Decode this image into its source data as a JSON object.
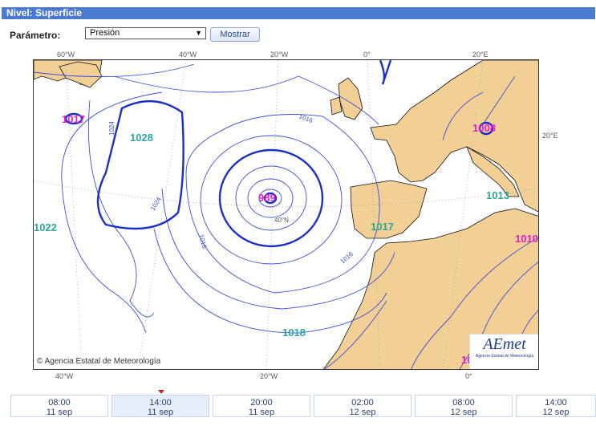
{
  "header": {
    "title": "Nivel: Superficie"
  },
  "form": {
    "param_label": "Parámetro:",
    "selected": "Presión",
    "button": "Mostrar"
  },
  "map": {
    "lon_top": [
      "60°W",
      "40°W",
      "20°W",
      "0°",
      "20°E"
    ],
    "lon_bottom": [
      "40°W",
      "20°W",
      "0°"
    ],
    "right_label": "20°E",
    "lat_label": "40°N",
    "isobars": [
      "1024",
      "1024",
      "1016",
      "1016",
      "1016"
    ],
    "centers": [
      {
        "value": "1017",
        "color": "#e020d0"
      },
      {
        "value": "1028",
        "color": "#2aa79a"
      },
      {
        "value": "989",
        "color": "#e020d0"
      },
      {
        "value": "1022",
        "color": "#2aa79a"
      },
      {
        "value": "1017",
        "color": "#2aa79a"
      },
      {
        "value": "1008",
        "color": "#e020d0"
      },
      {
        "value": "1013",
        "color": "#2aa79a"
      },
      {
        "value": "1010",
        "color": "#e020d0"
      },
      {
        "value": "1018",
        "color": "#2aa79a"
      },
      {
        "value": "10",
        "color": "#e020d0"
      }
    ],
    "credit": "Agencia Estatal de Meteorología",
    "logo": {
      "text": "AEmet",
      "sub": "Agencia Estatal de Meteorología"
    }
  },
  "timeline": [
    {
      "time": "08:00",
      "date": "11 sep",
      "active": false
    },
    {
      "time": "14:00",
      "date": "11 sep",
      "active": true
    },
    {
      "time": "20:00",
      "date": "11 sep",
      "active": false
    },
    {
      "time": "02:00",
      "date": "12 sep",
      "active": false
    },
    {
      "time": "08:00",
      "date": "12 sep",
      "active": false
    },
    {
      "time": "14:00",
      "date": "12 sep",
      "active": false
    }
  ]
}
